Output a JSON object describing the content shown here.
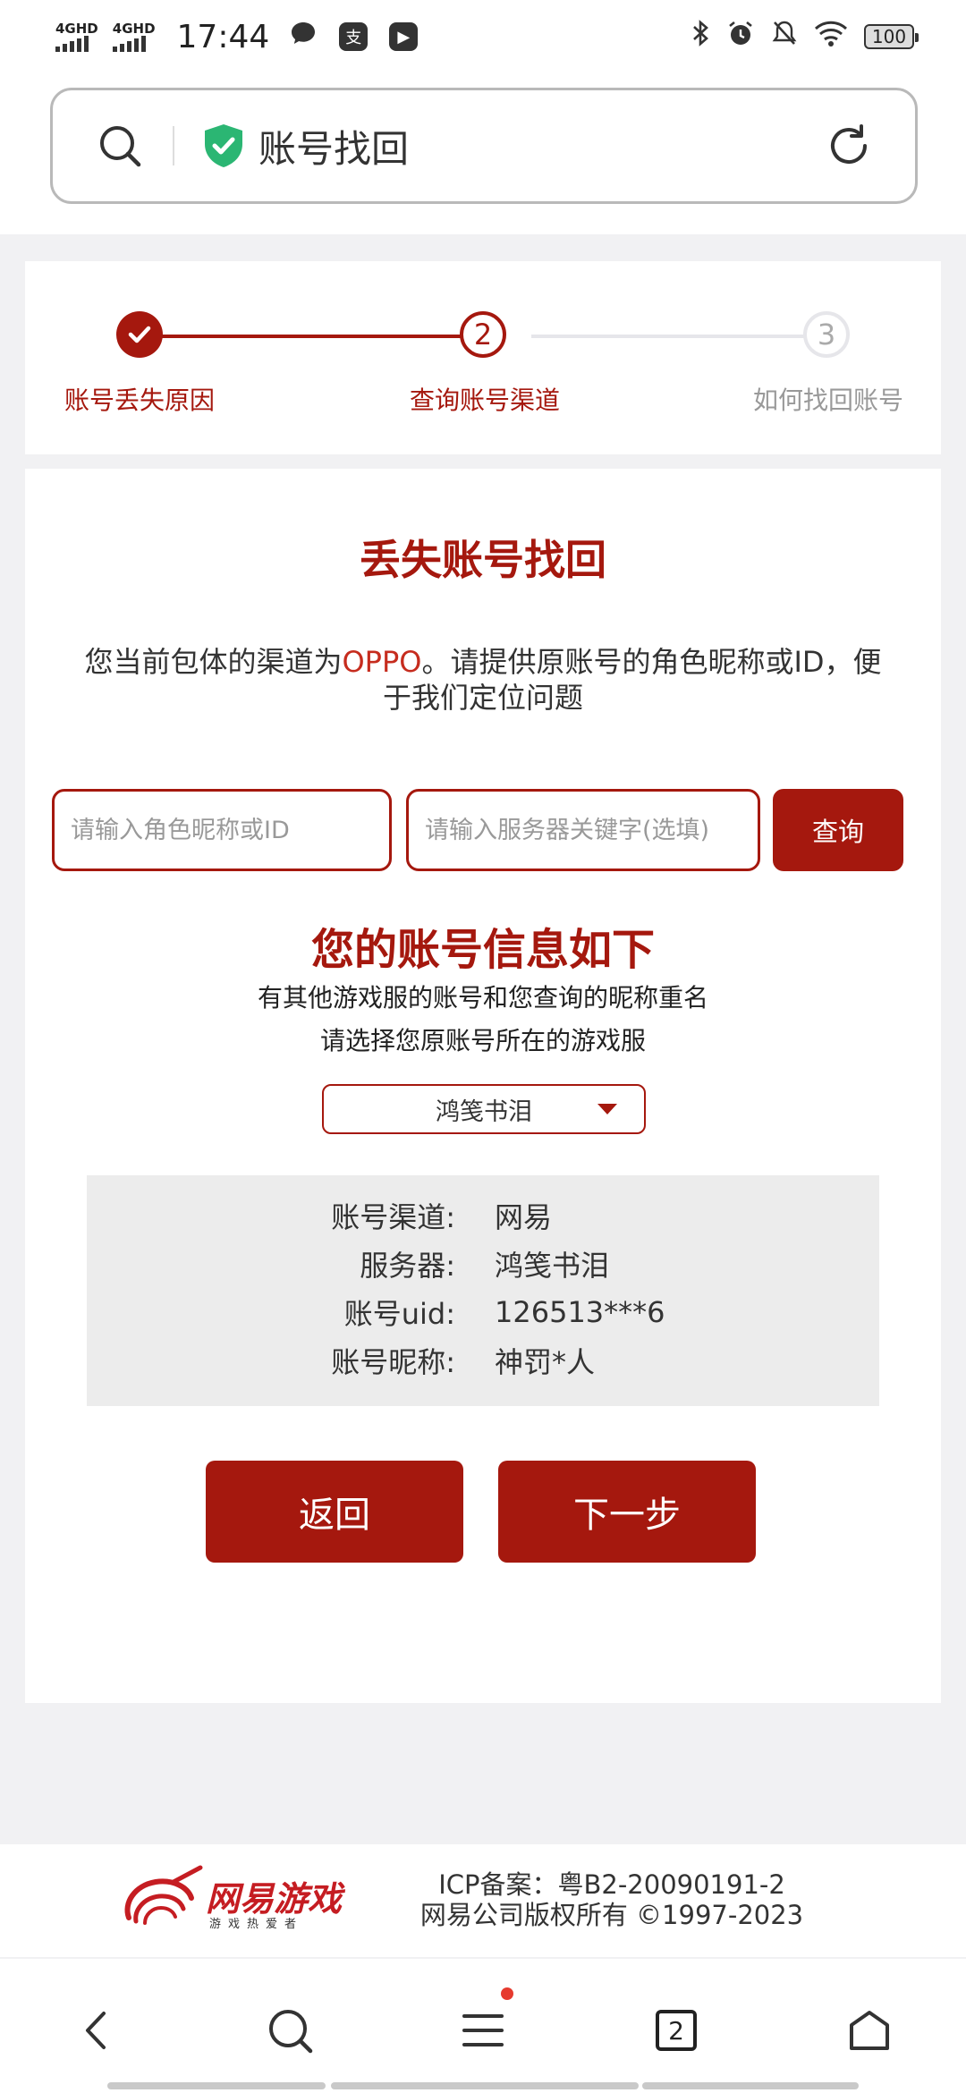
{
  "status_bar": {
    "network1": "4GHD",
    "network2": "4GHD",
    "time": "17:44",
    "battery": "100"
  },
  "browser": {
    "page_title": "账号找回"
  },
  "steps": [
    {
      "num": "1",
      "label": "账号丢失原因",
      "state": "done"
    },
    {
      "num": "2",
      "label": "查询账号渠道",
      "state": "current"
    },
    {
      "num": "3",
      "label": "如何找回账号",
      "state": "todo"
    }
  ],
  "main": {
    "title": "丢失账号找回",
    "desc_prefix": "您当前包体的渠道为",
    "desc_channel": "OPPO",
    "desc_suffix": "。请提供原账号的角色昵称或ID，便于我们定位问题",
    "nickname_placeholder": "请输入角色昵称或ID",
    "server_placeholder": "请输入服务器关键字(选填)",
    "query_label": "查询",
    "info_title": "您的账号信息如下",
    "info_sub1": "有其他游戏服的账号和您查询的昵称重名",
    "info_sub2": "请选择您原账号所在的游戏服",
    "selected_server": "鸿笺书泪",
    "info_rows": [
      {
        "key": "账号渠道:",
        "value": "网易"
      },
      {
        "key": "服务器:",
        "value": "鸿笺书泪"
      },
      {
        "key": "账号uid:",
        "value": "126513***6"
      },
      {
        "key": "账号昵称:",
        "value": "神罚*人"
      }
    ],
    "back_label": "返回",
    "next_label": "下一步"
  },
  "footer": {
    "logo_text": "网易游戏",
    "logo_slogan": "游戏热爱者",
    "icp": "ICP备案：粤B2-20090191-2",
    "copyright": "网易公司版权所有 ©1997-2023"
  },
  "bottom_nav": {
    "tab_count": "2"
  },
  "colors": {
    "accent": "#a5180e",
    "shield": "#2bb673"
  }
}
